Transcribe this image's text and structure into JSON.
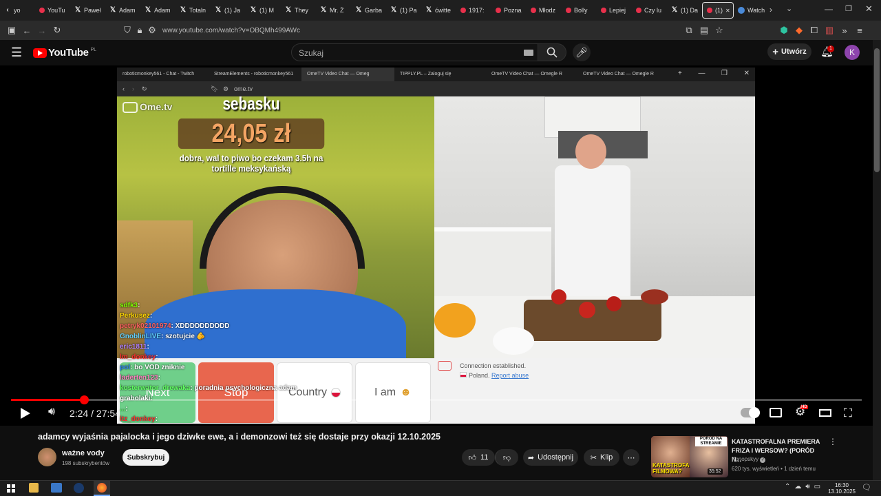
{
  "browser": {
    "tabs": [
      {
        "label": "yo",
        "icon": "chevron-left"
      },
      {
        "label": "YouTu",
        "icon": "youtube"
      },
      {
        "label": "Paweł",
        "icon": "x"
      },
      {
        "label": "Adam",
        "icon": "x"
      },
      {
        "label": "Adam",
        "icon": "x"
      },
      {
        "label": "Totaln",
        "icon": "x"
      },
      {
        "label": "(1) Ja",
        "icon": "x"
      },
      {
        "label": "(1) M",
        "icon": "x"
      },
      {
        "label": "They",
        "icon": "x"
      },
      {
        "label": "Mr. Ż",
        "icon": "x"
      },
      {
        "label": "Garba",
        "icon": "x"
      },
      {
        "label": "(1) Pa",
        "icon": "x"
      },
      {
        "label": "ćwitte",
        "icon": "x"
      },
      {
        "label": "1917:",
        "icon": "youtube"
      },
      {
        "label": "Pozna",
        "icon": "youtube"
      },
      {
        "label": "Młodz",
        "icon": "youtube"
      },
      {
        "label": "Bolly",
        "icon": "youtube"
      },
      {
        "label": "Lepiej",
        "icon": "youtube"
      },
      {
        "label": "Czy lu",
        "icon": "youtube"
      },
      {
        "label": "(1) Da",
        "icon": "x"
      },
      {
        "label": "(1)",
        "icon": "youtube"
      },
      {
        "label": "Watch",
        "icon": "watch"
      }
    ],
    "url": "www.youtube.com/watch?v=OBQMh499AWc"
  },
  "youtube": {
    "logo_text": "YouTube",
    "region": "PL",
    "search_placeholder": "Szukaj",
    "create_label": "Utwórz",
    "notif_count": "1",
    "avatar_letter": "K"
  },
  "stream": {
    "tabs": [
      "roboticmonkey561 - Chat - Twitch",
      "StreamElements - roboticmonkey561",
      "OmeTV Video Chat — Omeg",
      "TIPPLY.PL – Zaloguj się",
      "OmeTV Video Chat — Omegle R",
      "OmeTV Video Chat — Omegle R"
    ],
    "url": "ome.tv",
    "ome_logo": "Ome.tv",
    "donor": "sebasku",
    "amount": "24,05 zł",
    "donation_msg": "dobra, wal to piwo bo czekam 3.5h na tortille meksykańską",
    "chat": [
      {
        "user": "sdfk3",
        "msg": "",
        "color": "#7cfc00"
      },
      {
        "user": "Perkusez",
        "msg": "",
        "color": "#ffd700"
      },
      {
        "user": "petryk02101974",
        "msg": "XDDDDDDDDDD",
        "color": "#ff6060"
      },
      {
        "user": "GnoblinLIVE",
        "msg": "szotujcie 🫵",
        "color": "#60d0ff"
      },
      {
        "user": "eric1811",
        "msg": "",
        "color": "#b080ff"
      },
      {
        "user": "lm_donkey",
        "msg": "",
        "color": "#ff3030"
      },
      {
        "user": "pol",
        "msg": "bo VOD zniknie",
        "color": "#3080ff"
      },
      {
        "user": "laderten123",
        "msg": "",
        "color": "#ff80c0"
      },
      {
        "user": "kosterwator_drewaka",
        "msg": "poradnia psychologiczna adam",
        "color": "#60ff60"
      },
      {
        "user": "grabolaki",
        "msg": "",
        "color": "#ffffff"
      },
      {
        "user": "...",
        "msg": "",
        "color": "#60ff60"
      },
      {
        "user": "itz_donkey",
        "msg": "",
        "color": "#ff3030"
      }
    ],
    "ome_buttons": [
      "Next",
      "Stop",
      "Country",
      "I am"
    ],
    "connection_status": "Connection established.",
    "connection_country": "Poland.",
    "report_abuse": "Report abuse"
  },
  "player": {
    "time": "2:24 / 27:54",
    "progress_fraction": 0.086
  },
  "video": {
    "title": "adamcy wyjaśnia pajalocka i jego dziwke ewe, a i demonzowi też się dostaje przy okazji 12.10.2025",
    "channel": "ważne vody",
    "subs": "198 subskrybentów",
    "subscribe": "Subskrybuj",
    "likes": "11",
    "share": "Udostępnij",
    "clip": "Klip"
  },
  "recommendation": {
    "title": "KATASTROFALNA PREMIERA FRIZA I WERSOW? (PORÓD N...",
    "channel": "Konopskyy",
    "meta": "620 tys. wyświetleń • 1 dzień temu",
    "duration": "35:52",
    "thumb_top": "PORÓD NA STREAMIE",
    "thumb_bottom": "KATASTROFA FILMOWA?"
  },
  "taskbar": {
    "time": "16:30",
    "date": "13.10.2025"
  },
  "colors": {
    "youtube_red": "#ff0000",
    "progress_red": "#f00",
    "avatar_purple": "#8e44ad"
  }
}
